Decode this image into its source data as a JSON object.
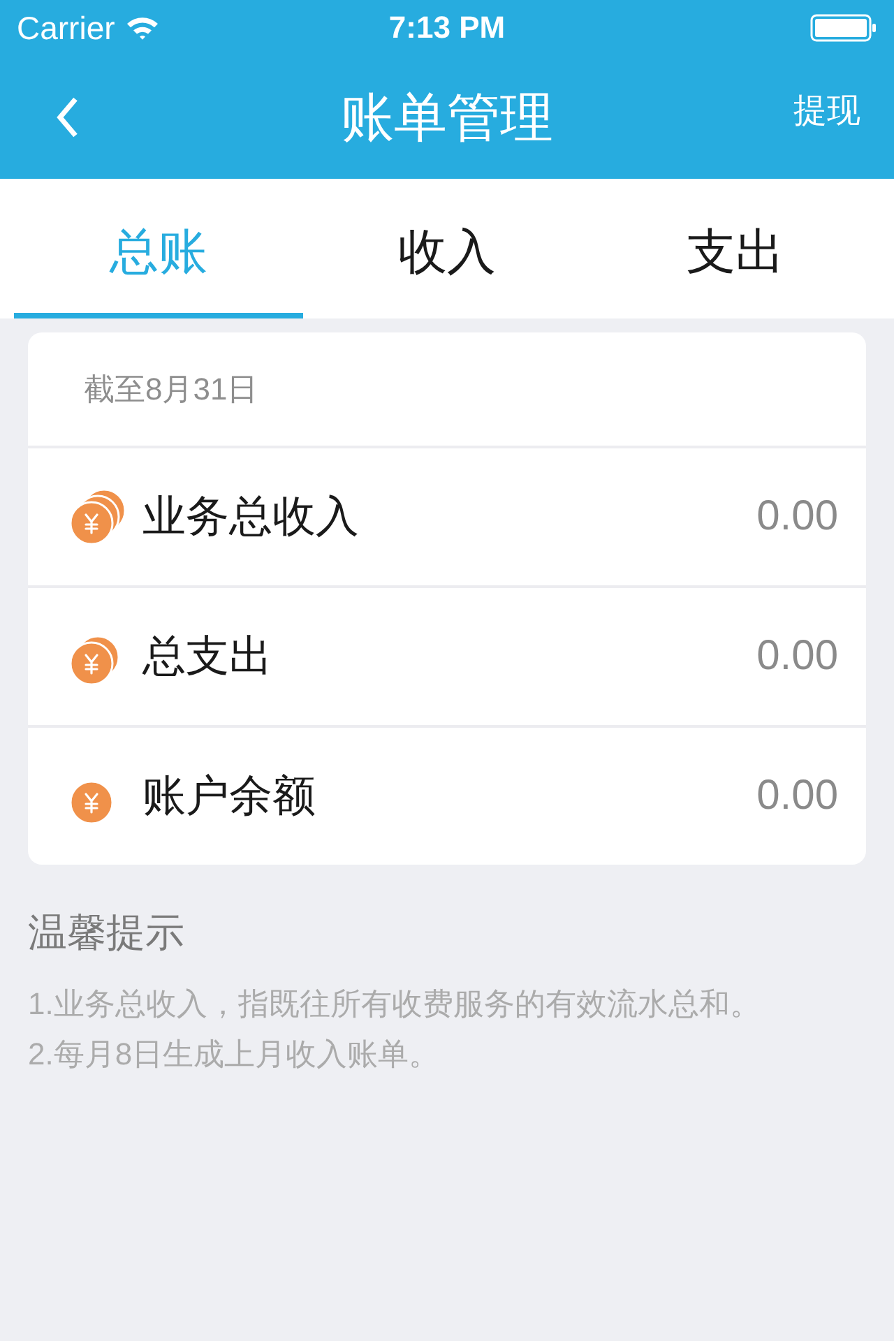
{
  "status_bar": {
    "carrier": "Carrier",
    "time": "7:13 PM"
  },
  "nav_bar": {
    "title": "账单管理",
    "action": "提现"
  },
  "tabs": [
    {
      "label": "总账",
      "selected": true
    },
    {
      "label": "收入",
      "selected": false
    },
    {
      "label": "支出",
      "selected": false
    }
  ],
  "summary": {
    "date_note": "截至8月31日",
    "rows": [
      {
        "kind": "stack",
        "label": "业务总收入",
        "value": "0.00"
      },
      {
        "kind": "pair",
        "label": "总支出",
        "value": "0.00"
      },
      {
        "kind": "single",
        "label": "账户余额",
        "value": "0.00"
      }
    ]
  },
  "tips": {
    "title": "温馨提示",
    "lines": [
      "1.业务总收入，指既往所有收费服务的有效流水总和。",
      "2.每月8日生成上月收入账单。"
    ]
  }
}
